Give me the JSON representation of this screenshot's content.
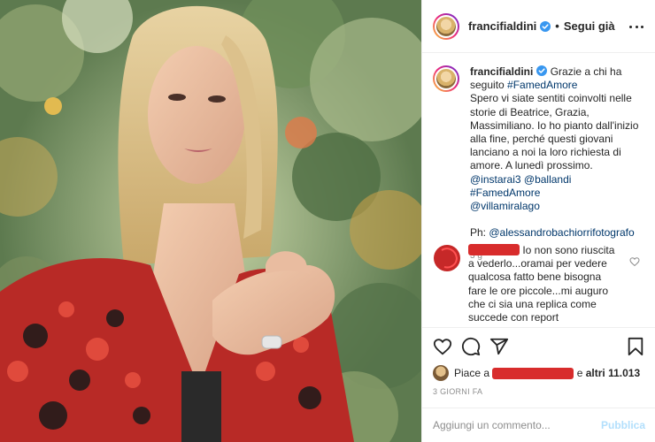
{
  "post": {
    "username": "francifialdini",
    "separator": "•",
    "follow_label": "Segui già",
    "caption": {
      "intro": "Grazie a chi ha seguito",
      "hashtag_1": "#FamedAmore",
      "body": "Spero vi siate sentiti coinvolti nelle storie di Beatrice, Grazia, Massimiliano. Io ho pianto dall'inizio alla fine, perché questi giovani lanciano a noi la loro richiesta di amore. A lunedì prossimo.",
      "mention_1": "@instarai3",
      "mention_2": "@ballandi",
      "hashtag_2": "#FamedAmore",
      "mention_3": "@villamiralago",
      "ph_label": "Ph:",
      "ph_mention": "@alessandrobachiorrifotografo",
      "time": "3 g"
    },
    "comment": {
      "text": "Io non sono riuscita a vederlo...oramai per vedere qualcosa fatto bene bisogna fare le ore piccole...mi auguro che ci sia una replica come succede con report"
    },
    "likes": {
      "prefix": "Piace a",
      "suffix_and": "e",
      "others": "altri 11.013"
    },
    "date": "3 GIORNI FA",
    "add_comment": {
      "placeholder": "Aggiungi un commento...",
      "publish_label": "Pubblica"
    }
  },
  "colors": {
    "link": "#00376b",
    "secondary": "#8e8e8e",
    "verified": "#3897f0",
    "publish_disabled": "#b2dffc",
    "redaction": "#d82c2c"
  },
  "icons": [
    "verified-badge-icon",
    "more-options-icon",
    "heart-icon",
    "comment-icon",
    "share-icon",
    "bookmark-icon"
  ]
}
